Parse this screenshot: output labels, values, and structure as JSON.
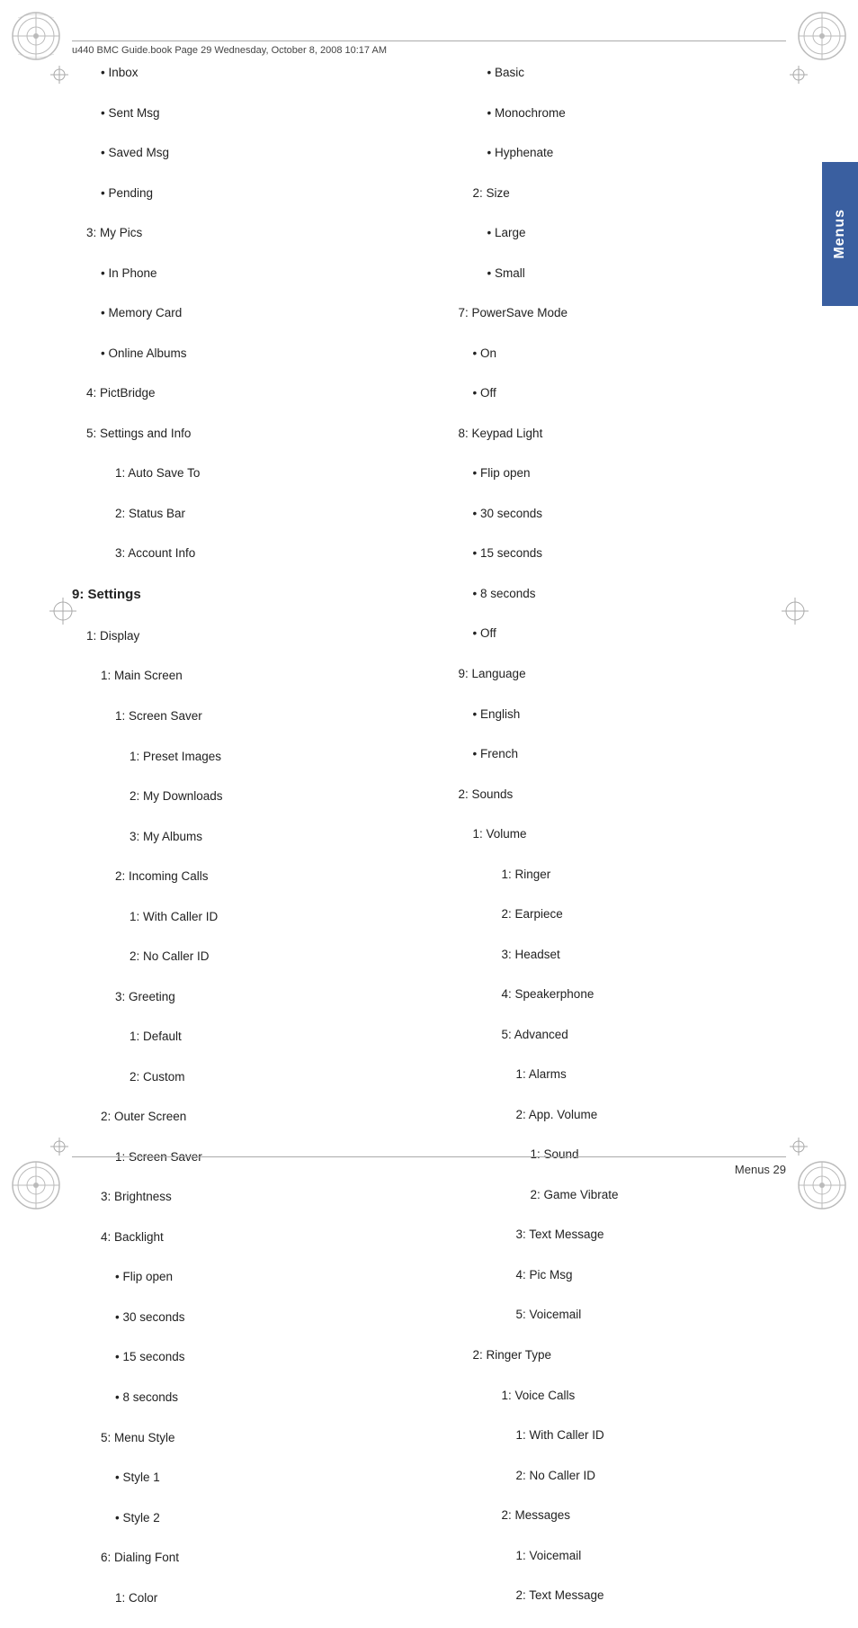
{
  "header": {
    "book_ref": "u440 BMC Guide.book  Page 29  Wednesday, October 8, 2008  10:17 AM"
  },
  "side_tab": {
    "label": "Menus"
  },
  "footer": {
    "text": "Menus   29"
  },
  "left_column": [
    {
      "text": "• Inbox",
      "indent": "indent-2"
    },
    {
      "text": "• Sent Msg",
      "indent": "indent-2"
    },
    {
      "text": "• Saved Msg",
      "indent": "indent-2"
    },
    {
      "text": "• Pending",
      "indent": "indent-2"
    },
    {
      "text": "3: My Pics",
      "indent": "indent-1"
    },
    {
      "text": "• In Phone",
      "indent": "indent-2"
    },
    {
      "text": "• Memory Card",
      "indent": "indent-2"
    },
    {
      "text": "• Online Albums",
      "indent": "indent-2"
    },
    {
      "text": "4: PictBridge",
      "indent": "indent-1"
    },
    {
      "text": "5: Settings and Info",
      "indent": "indent-1"
    },
    {
      "text": "1: Auto Save To",
      "indent": "indent-3"
    },
    {
      "text": "2: Status Bar",
      "indent": "indent-3"
    },
    {
      "text": "3: Account Info",
      "indent": "indent-3"
    },
    {
      "text": "9: Settings",
      "indent": "indent-0",
      "bold": true
    },
    {
      "text": "1: Display",
      "indent": "indent-1"
    },
    {
      "text": "1: Main Screen",
      "indent": "indent-2"
    },
    {
      "text": "1: Screen Saver",
      "indent": "indent-3"
    },
    {
      "text": "1: Preset Images",
      "indent": "indent-4"
    },
    {
      "text": "2: My Downloads",
      "indent": "indent-4"
    },
    {
      "text": "3: My Albums",
      "indent": "indent-4"
    },
    {
      "text": "2: Incoming Calls",
      "indent": "indent-3"
    },
    {
      "text": "1: With Caller ID",
      "indent": "indent-4"
    },
    {
      "text": "2: No Caller ID",
      "indent": "indent-4"
    },
    {
      "text": "3: Greeting",
      "indent": "indent-3"
    },
    {
      "text": "1: Default",
      "indent": "indent-4"
    },
    {
      "text": "2: Custom",
      "indent": "indent-4"
    },
    {
      "text": "2: Outer Screen",
      "indent": "indent-2"
    },
    {
      "text": "1: Screen Saver",
      "indent": "indent-3"
    },
    {
      "text": "3: Brightness",
      "indent": "indent-2"
    },
    {
      "text": "4: Backlight",
      "indent": "indent-2"
    },
    {
      "text": "• Flip open",
      "indent": "indent-3"
    },
    {
      "text": "• 30 seconds",
      "indent": "indent-3"
    },
    {
      "text": "• 15 seconds",
      "indent": "indent-3"
    },
    {
      "text": "• 8 seconds",
      "indent": "indent-3"
    },
    {
      "text": "5: Menu Style",
      "indent": "indent-2"
    },
    {
      "text": "• Style 1",
      "indent": "indent-3"
    },
    {
      "text": "• Style 2",
      "indent": "indent-3"
    },
    {
      "text": "6: Dialing Font",
      "indent": "indent-2"
    },
    {
      "text": "1: Color",
      "indent": "indent-3"
    }
  ],
  "right_column": [
    {
      "text": "• Basic",
      "indent": "indent-2"
    },
    {
      "text": "• Monochrome",
      "indent": "indent-2"
    },
    {
      "text": "• Hyphenate",
      "indent": "indent-2"
    },
    {
      "text": "2: Size",
      "indent": "indent-1"
    },
    {
      "text": "• Large",
      "indent": "indent-2"
    },
    {
      "text": "• Small",
      "indent": "indent-2"
    },
    {
      "text": "7: PowerSave Mode",
      "indent": "indent-0"
    },
    {
      "text": "• On",
      "indent": "indent-1"
    },
    {
      "text": "• Off",
      "indent": "indent-1"
    },
    {
      "text": "8: Keypad Light",
      "indent": "indent-0"
    },
    {
      "text": "• Flip open",
      "indent": "indent-1"
    },
    {
      "text": "• 30 seconds",
      "indent": "indent-1"
    },
    {
      "text": "• 15 seconds",
      "indent": "indent-1"
    },
    {
      "text": "• 8 seconds",
      "indent": "indent-1"
    },
    {
      "text": "• Off",
      "indent": "indent-1"
    },
    {
      "text": "9: Language",
      "indent": "indent-0"
    },
    {
      "text": "• English",
      "indent": "indent-1"
    },
    {
      "text": "• French",
      "indent": "indent-1"
    },
    {
      "text": "2: Sounds",
      "indent": "indent-0"
    },
    {
      "text": "1: Volume",
      "indent": "indent-1"
    },
    {
      "text": "1: Ringer",
      "indent": "indent-3"
    },
    {
      "text": "2: Earpiece",
      "indent": "indent-3"
    },
    {
      "text": "3: Headset",
      "indent": "indent-3"
    },
    {
      "text": "4: Speakerphone",
      "indent": "indent-3"
    },
    {
      "text": "5: Advanced",
      "indent": "indent-3"
    },
    {
      "text": "1: Alarms",
      "indent": "indent-4"
    },
    {
      "text": "2: App. Volume",
      "indent": "indent-4"
    },
    {
      "text": "1: Sound",
      "indent": "indent-5"
    },
    {
      "text": "2: Game Vibrate",
      "indent": "indent-5"
    },
    {
      "text": "3: Text Message",
      "indent": "indent-4"
    },
    {
      "text": "4: Pic Msg",
      "indent": "indent-4"
    },
    {
      "text": "5: Voicemail",
      "indent": "indent-4"
    },
    {
      "text": "2: Ringer Type",
      "indent": "indent-1"
    },
    {
      "text": "1: Voice Calls",
      "indent": "indent-3"
    },
    {
      "text": "1: With Caller ID",
      "indent": "indent-4"
    },
    {
      "text": "2: No Caller ID",
      "indent": "indent-4"
    },
    {
      "text": "2: Messages",
      "indent": "indent-3"
    },
    {
      "text": "1: Voicemail",
      "indent": "indent-4"
    },
    {
      "text": "2: Text Message",
      "indent": "indent-4"
    }
  ]
}
